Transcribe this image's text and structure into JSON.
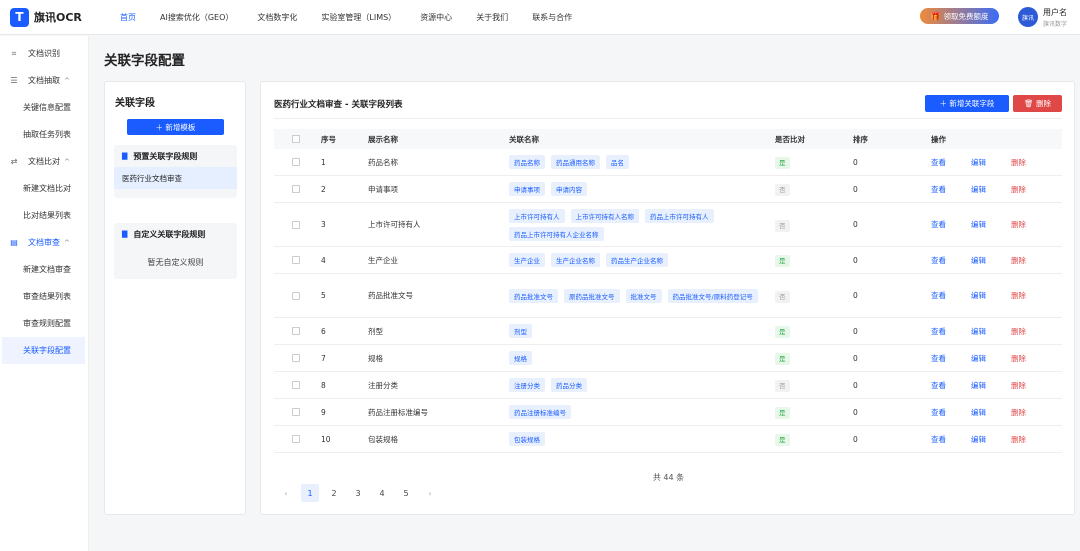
{
  "header": {
    "logo_mark": "T",
    "logo_text": "旗讯OCR",
    "nav": [
      {
        "label": "首页",
        "active": true
      },
      {
        "label": "AI搜索优化（GEO）"
      },
      {
        "label": "文档数字化"
      },
      {
        "label": "实验室管理（LIMS）"
      },
      {
        "label": "资源中心"
      },
      {
        "label": "关于我们"
      },
      {
        "label": "联系与合作"
      }
    ],
    "promo_icon": "gift-icon",
    "promo_label": "领取免费额度",
    "avatar_text": "旗讯",
    "user_name": "用户名",
    "user_org": "旗讯数字"
  },
  "sidebar": {
    "items": [
      {
        "label": "文档识别",
        "icon": "scan-icon",
        "glyph": "⌗",
        "type": "top"
      },
      {
        "label": "文档抽取",
        "icon": "list-icon",
        "glyph": "☰",
        "type": "group",
        "caret": "^"
      },
      {
        "label": "关键信息配置",
        "type": "sub"
      },
      {
        "label": "抽取任务列表",
        "type": "sub"
      },
      {
        "label": "文档比对",
        "icon": "compare-icon",
        "glyph": "⇄",
        "type": "group",
        "caret": "^"
      },
      {
        "label": "新建文档比对",
        "type": "sub"
      },
      {
        "label": "比对结果列表",
        "type": "sub"
      },
      {
        "label": "文档审查",
        "icon": "review-icon",
        "glyph": "▤",
        "type": "group-active",
        "caret": "^"
      },
      {
        "label": "新建文档审查",
        "type": "sub"
      },
      {
        "label": "审查结果列表",
        "type": "sub"
      },
      {
        "label": "审查规则配置",
        "type": "sub"
      },
      {
        "label": "关联字段配置",
        "type": "active"
      }
    ]
  },
  "page": {
    "title": "关联字段配置"
  },
  "left_panel": {
    "title": "关联字段",
    "new_template_label": "＋ 新增模板",
    "preset_title": "预置关联字段规则",
    "preset_rule": "医药行业文档审查",
    "custom_title": "自定义关联字段规则",
    "custom_empty": "暂无自定义规则"
  },
  "main_panel": {
    "title": "医药行业文档审查 - 关联字段列表",
    "add_label": "＋ 新增关联字段",
    "delete_label": "🗑 删除",
    "columns": [
      "序号",
      "展示名称",
      "关联名称",
      "是否比对",
      "排序",
      "操作"
    ],
    "rows": [
      {
        "no": "1",
        "name": "药品名称",
        "tags": [
          "药品名称",
          "药品通用名称",
          "品名"
        ],
        "compare": "是",
        "sort": "0"
      },
      {
        "no": "2",
        "name": "申请事项",
        "tags": [
          "申请事项",
          "申请内容"
        ],
        "compare": "否",
        "sort": "0"
      },
      {
        "no": "3",
        "name": "上市许可持有人",
        "tags": [
          "上市许可持有人",
          "上市许可持有人名称",
          "药品上市许可持有人",
          "药品上市许可持有人企业名称"
        ],
        "compare": "否",
        "sort": "0"
      },
      {
        "no": "4",
        "name": "生产企业",
        "tags": [
          "生产企业",
          "生产企业名称",
          "药品生产企业名称"
        ],
        "compare": "是",
        "sort": "0"
      },
      {
        "no": "5",
        "name": "药品批准文号",
        "tags": [
          "药品批准文号",
          "原药品批准文号",
          "批准文号",
          "药品批准文号/原料药登记号"
        ],
        "compare": "否",
        "sort": "0"
      },
      {
        "no": "6",
        "name": "剂型",
        "tags": [
          "剂型"
        ],
        "compare": "是",
        "sort": "0"
      },
      {
        "no": "7",
        "name": "规格",
        "tags": [
          "规格"
        ],
        "compare": "是",
        "sort": "0"
      },
      {
        "no": "8",
        "name": "注册分类",
        "tags": [
          "注册分类",
          "药品分类"
        ],
        "compare": "否",
        "sort": "0"
      },
      {
        "no": "9",
        "name": "药品注册标准编号",
        "tags": [
          "药品注册标准编号"
        ],
        "compare": "是",
        "sort": "0"
      },
      {
        "no": "10",
        "name": "包装规格",
        "tags": [
          "包装规格"
        ],
        "compare": "是",
        "sort": "0"
      }
    ],
    "ops": {
      "view": "查看",
      "edit": "编辑",
      "del": "删除"
    },
    "total": "共 44 条",
    "pages": [
      "1",
      "2",
      "3",
      "4",
      "5"
    ],
    "prev": "‹",
    "next": "›"
  },
  "colors": {
    "primary": "#1a5cff",
    "danger": "#e04848",
    "success": "#2eaa4a"
  }
}
